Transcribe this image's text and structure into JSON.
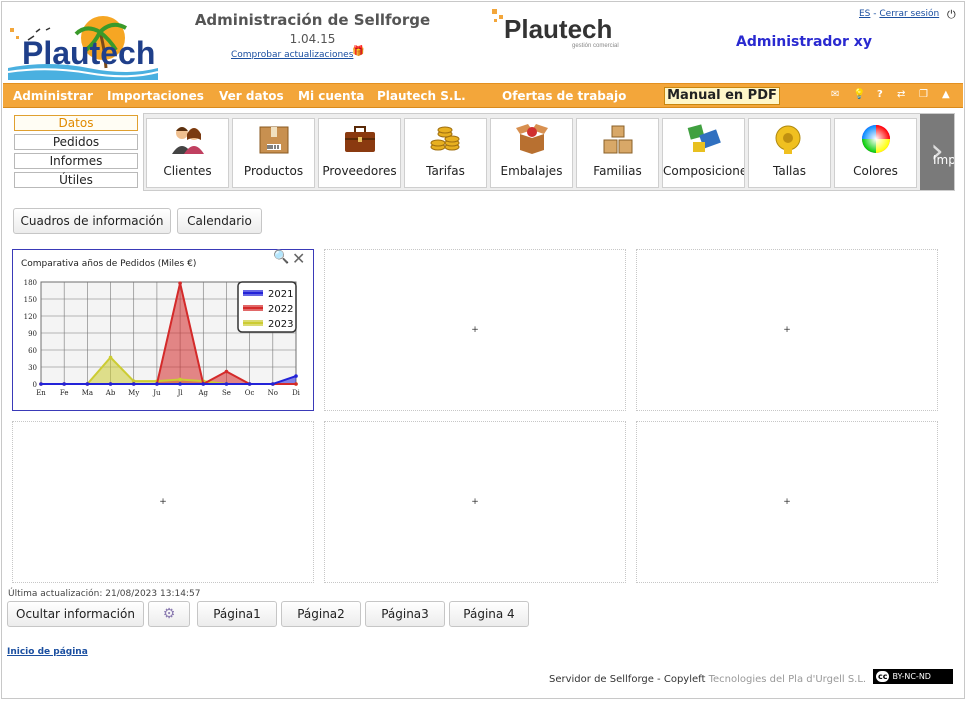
{
  "header": {
    "logo_text": "Plautech",
    "title": "Administración de Sellforge",
    "version": "1.04.15",
    "update_link": "Comprobar actualizaciones",
    "lang": "ES",
    "logout": "Cerrar sesión",
    "user": "Administrador xy",
    "center_logo_text": "Plautech",
    "center_logo_sub": "gestión comercial"
  },
  "menu": {
    "items": [
      "Administrar",
      "Importaciones",
      "Ver datos",
      "Mi cuenta",
      "Plautech S.L.",
      "Ofertas de trabajo"
    ],
    "manual": "Manual en PDF"
  },
  "side_tabs": [
    "Datos",
    "Pedidos",
    "Informes",
    "Útiles"
  ],
  "tiles": [
    {
      "label": "Clientes",
      "icon": "people-icon"
    },
    {
      "label": "Productos",
      "icon": "box-icon"
    },
    {
      "label": "Proveedores",
      "icon": "briefcase-icon"
    },
    {
      "label": "Tarifas",
      "icon": "coins-icon"
    },
    {
      "label": "Embalajes",
      "icon": "open-box-icon"
    },
    {
      "label": "Familias",
      "icon": "boxes-icon"
    },
    {
      "label": "Composiciones",
      "icon": "composition-icon"
    },
    {
      "label": "Tallas",
      "icon": "tape-measure-icon"
    },
    {
      "label": "Colores",
      "icon": "color-wheel-icon"
    }
  ],
  "next_tile_label": "Imp",
  "dashboard_buttons": [
    "Cuadros de información",
    "Calendario"
  ],
  "chart_panel_title": "Comparativa años de Pedidos (Miles €)",
  "chart_data": {
    "type": "area",
    "title": "Comparativa años de Pedidos (Miles €)",
    "categories": [
      "En",
      "Fe",
      "Ma",
      "Ab",
      "My",
      "Ju",
      "Jl",
      "Ag",
      "Se",
      "Oc",
      "No",
      "Di"
    ],
    "ylim": [
      0,
      180
    ],
    "yticks": [
      0,
      30,
      60,
      90,
      120,
      150,
      180
    ],
    "grid": true,
    "legend_position": "top-right",
    "series": [
      {
        "name": "2021",
        "color": "#2323d8",
        "values": [
          0,
          0,
          0,
          0,
          0,
          0,
          0,
          0,
          0,
          0,
          0,
          14
        ]
      },
      {
        "name": "2022",
        "color": "#d42a2a",
        "values": [
          0,
          0,
          0,
          0,
          0,
          0,
          178,
          0,
          22,
          0,
          0,
          0
        ]
      },
      {
        "name": "2023",
        "color": "#cccc33",
        "values": [
          0,
          0,
          0,
          47,
          5,
          5,
          8,
          5,
          0,
          0,
          0,
          0
        ]
      }
    ]
  },
  "empty_panel_symbol": "+",
  "last_update": "Última actualización: 21/08/2023 13:14:57",
  "bottom": {
    "hide_label": "Ocultar información",
    "pages": [
      "Página1",
      "Página2",
      "Página3",
      "Página 4"
    ]
  },
  "top_link": "Inicio de página",
  "footer": {
    "text": "Servidor de Sellforge - Copyleft ",
    "company": "Tecnologies del Pla d'Urgell S.L.",
    "license": "BY-NC-ND",
    "cc": "cc"
  }
}
